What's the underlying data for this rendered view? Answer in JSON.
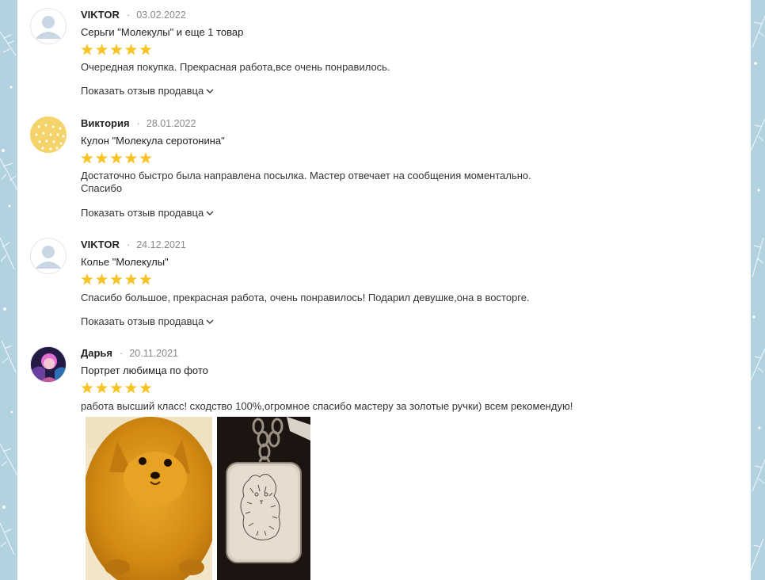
{
  "reviews": [
    {
      "name": "VIKTOR",
      "date": "03.02.2022",
      "product": "Серьги \"Молекулы\" и еще 1 товар",
      "rating": 5,
      "text": "Очередная покупка. Прекрасная работа,все очень понравилось.",
      "seller_link": "Показать отзыв продавца",
      "avatar": "default-avatar"
    },
    {
      "name": "Виктория",
      "date": "28.01.2022",
      "product": "Кулон \"Молекула серотонина\"",
      "rating": 5,
      "text_lines": [
        "Достаточно быстро была направлена посылка. Мастер отвечает на сообщения моментально.",
        "Спасибо"
      ],
      "seller_link": "Показать отзыв продавца",
      "avatar": "yellow-dotted-avatar"
    },
    {
      "name": "VIKTOR",
      "date": "24.12.2021",
      "product": "Колье \"Молекулы\"",
      "rating": 5,
      "text": "Спасибо большое, прекрасная работа, очень понравилось! Подарил девушке,она в восторге.",
      "seller_link": "Показать отзыв продавца",
      "avatar": "default-avatar"
    },
    {
      "name": "Дарья",
      "date": "20.11.2021",
      "product": "Портрет любимца по фото",
      "rating": 5,
      "text": "работа высший класс! сходство 100%,огромное спасибо мастеру за золотые ручки) всем рекомендую!",
      "avatar": "photo-avatar",
      "photos": [
        "pomeranian-dog-photo",
        "engraved-pendant-photo"
      ]
    }
  ],
  "colors": {
    "star": "#f7c325",
    "accent_bg": "#b3d2e0"
  }
}
